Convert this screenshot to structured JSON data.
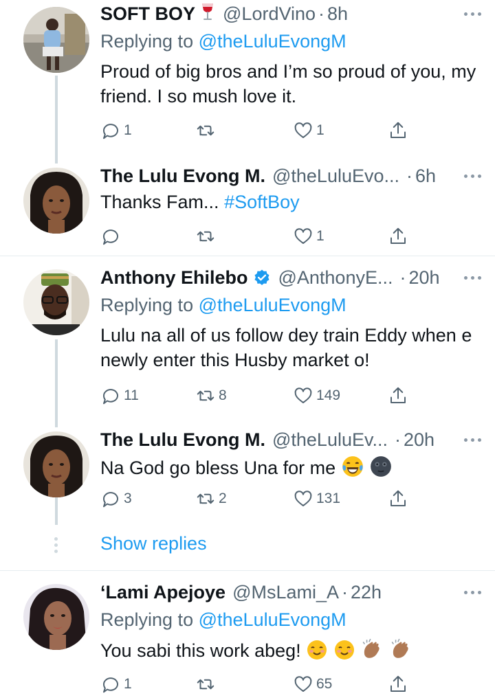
{
  "tweets": [
    {
      "name": "SOFT BOY",
      "name_emoji": "wine-glass",
      "handle": "@LordVino",
      "time": "8h",
      "replying_label": "Replying to",
      "replying_to": "@theLuluEvongM",
      "text": "Proud of big bros and I’m so proud of you, my friend. I so mush love it.",
      "replies": "1",
      "retweets": "",
      "likes": "1"
    },
    {
      "name": "The Lulu Evong M.",
      "handle": "@theLuluEvo...",
      "time": "6h",
      "text": "Thanks Fam...",
      "hashtag": "#SoftBoy",
      "replies": "",
      "retweets": "",
      "likes": "1"
    },
    {
      "name": "Anthony Ehilebo",
      "verified": true,
      "handle": "@AnthonyE...",
      "time": "20h",
      "replying_label": "Replying to",
      "replying_to": "@theLuluEvongM",
      "text": "Lulu na all of us follow dey train Eddy when e newly enter this Husby market o!",
      "replies": "11",
      "retweets": "8",
      "likes": "149"
    },
    {
      "name": "The Lulu Evong M.",
      "handle": "@theLuluEv...",
      "time": "20h",
      "text": "Na God go bless Una for me",
      "emojis": [
        "face-with-tears-of-joy",
        "new-moon-face"
      ],
      "replies": "3",
      "retweets": "2",
      "likes": "131"
    },
    {
      "name": "‘Lami Apejoye",
      "handle": "@MsLami_A",
      "time": "22h",
      "replying_label": "Replying to",
      "replying_to": "@theLuluEvongM",
      "text": "You sabi this work abeg!",
      "emojis": [
        "smiling-face",
        "smiling-face",
        "clapping-hands",
        "clapping-hands"
      ],
      "replies": "1",
      "retweets": "",
      "likes": "65"
    }
  ],
  "show_replies": "Show replies",
  "separator_dot": "·",
  "colors": {
    "link": "#1d9bf0",
    "secondary": "#536471",
    "text": "#0f1419",
    "thread_line": "#cfd9de"
  }
}
